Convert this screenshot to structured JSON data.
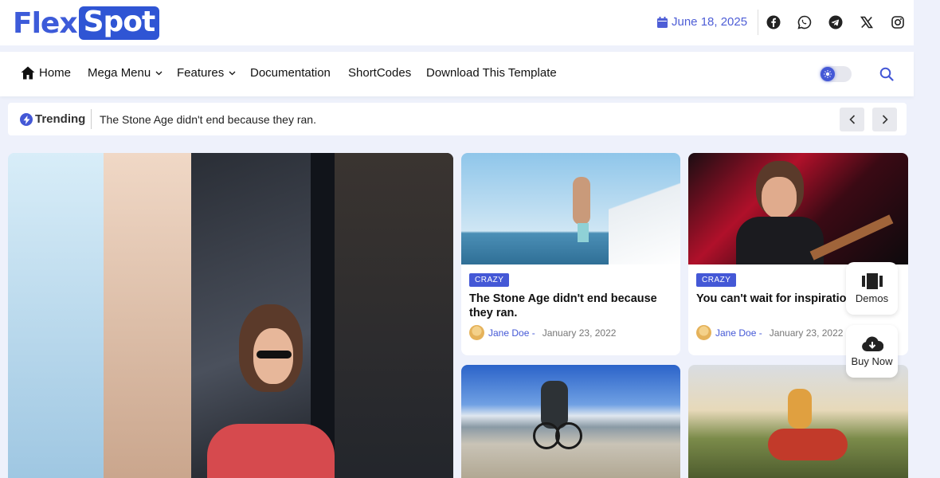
{
  "header": {
    "logo": {
      "part1": "Flex",
      "part2": "Spot"
    },
    "date": "June 18, 2025",
    "social_icons": [
      "facebook-icon",
      "whatsapp-icon",
      "telegram-icon",
      "x-icon",
      "instagram-icon"
    ]
  },
  "nav": {
    "items": [
      {
        "label": "Home",
        "icon": "home-icon"
      },
      {
        "label": "Mega Menu",
        "has_dropdown": true
      },
      {
        "label": "Features",
        "has_dropdown": true
      },
      {
        "label": "Documentation"
      },
      {
        "label": "ShortCodes"
      },
      {
        "label": "Download This Template"
      }
    ]
  },
  "trending": {
    "label": "Trending",
    "text": "The Stone Age didn't end because they ran."
  },
  "cards": [
    {
      "badge": "CRAZY",
      "title": "The Stone Age didn't end because they ran.",
      "author": "Jane Doe -",
      "date": "January 23, 2022"
    },
    {
      "badge": "CRAZY",
      "title": "You can't wait for inspiration to go.",
      "author": "Jane Doe -",
      "date": "January 23, 2022"
    }
  ],
  "floating": {
    "demos_label": "Demos",
    "buy_label": "Buy Now"
  },
  "colors": {
    "accent": "#4458d6",
    "logo_blue": "#2f55d4",
    "page_bg": "#eef1fb"
  }
}
